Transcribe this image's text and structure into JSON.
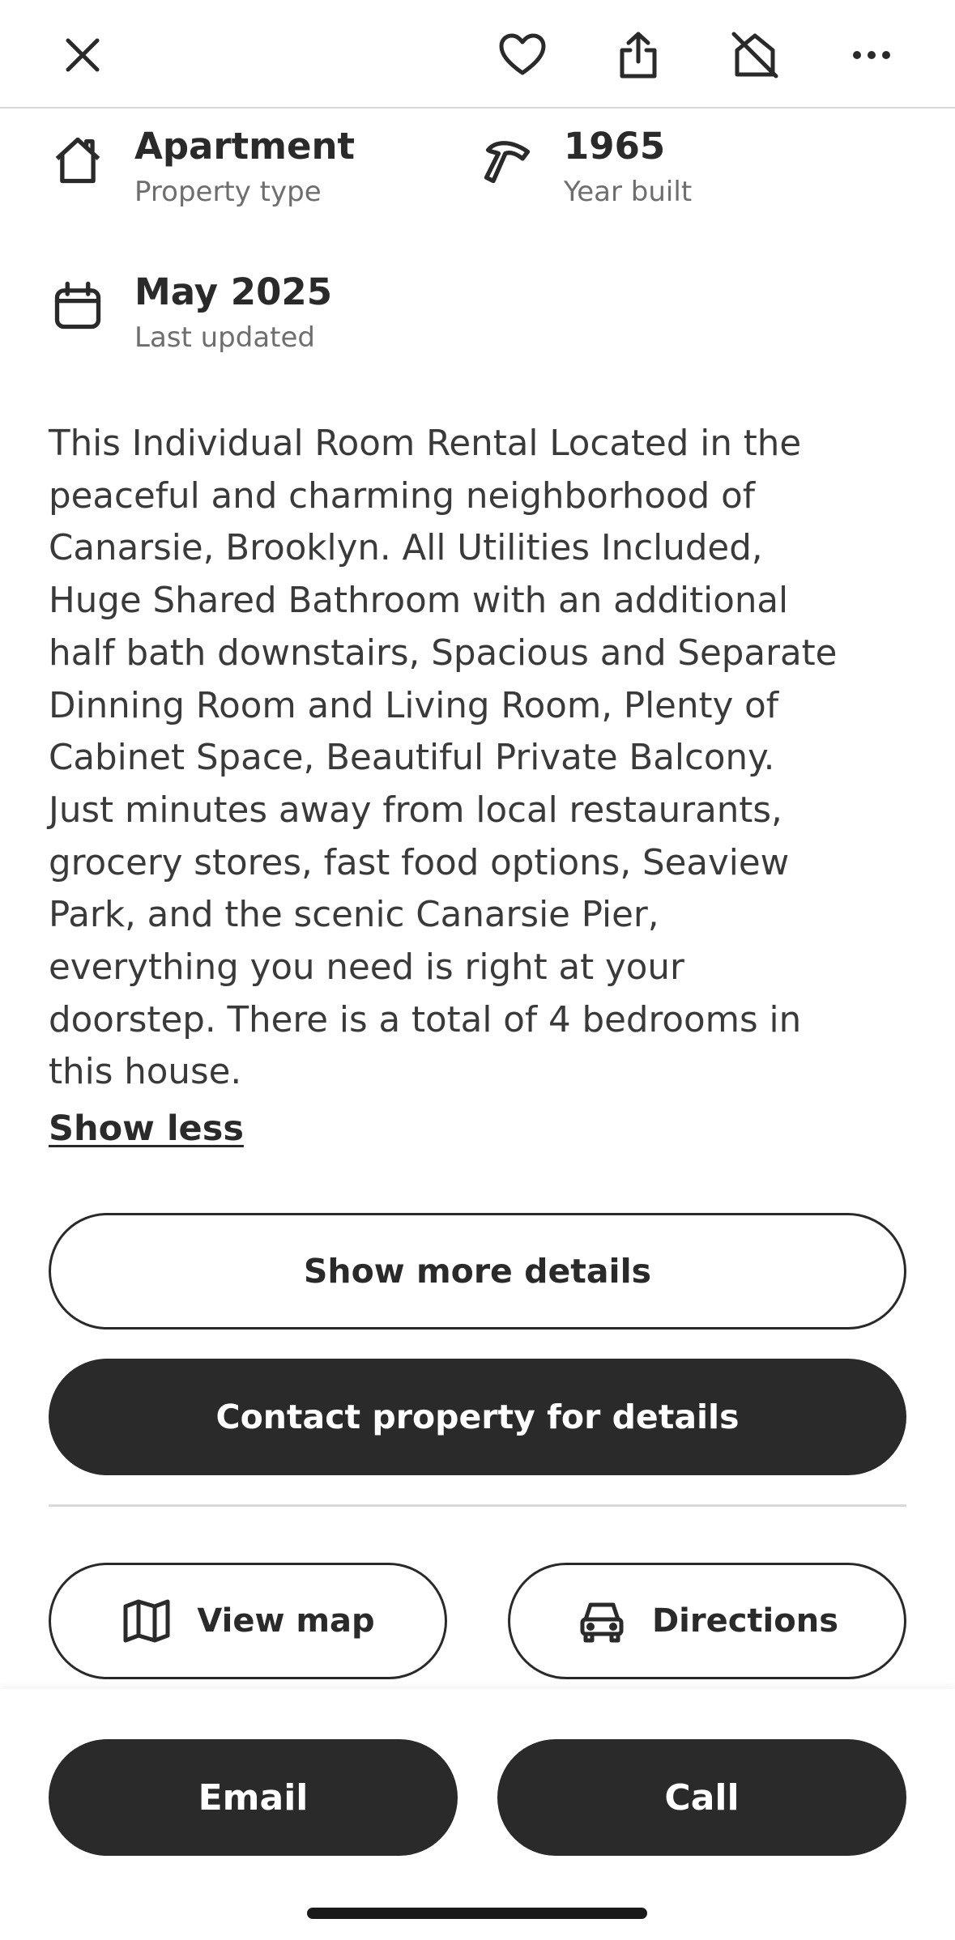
{
  "toolbar": {
    "icons": [
      "close-icon",
      "heart-icon",
      "share-icon",
      "hide-icon",
      "more-icon"
    ]
  },
  "facts": {
    "property_type": {
      "value": "Apartment",
      "label": "Property type",
      "icon": "house-icon"
    },
    "year_built": {
      "value": "1965",
      "label": "Year built",
      "icon": "hammer-icon"
    },
    "last_updated": {
      "value": "May 2025",
      "label": "Last updated",
      "icon": "calendar-icon"
    }
  },
  "description": {
    "lines": [
      "This Individual Room Rental Located in the",
      "peaceful and charming neighborhood of",
      "Canarsie, Brooklyn. All Utilities Included,",
      "Huge Shared Bathroom with an additional",
      "half bath downstairs, Spacious and Separate",
      "Dinning Room and Living Room, Plenty of",
      "Cabinet Space, Beautiful Private Balcony.",
      "Just minutes away from local restaurants,",
      "grocery stores, fast food options, Seaview",
      "Park, and the scenic Canarsie Pier,",
      "everything you need is right at your",
      "doorstep. There is a total of 4 bedrooms in",
      "this house."
    ],
    "toggle_label": "Show less"
  },
  "actions": {
    "show_more_details": "Show more details",
    "contact_property": "Contact property for details",
    "view_map": "View map",
    "directions": "Directions"
  },
  "bottom_bar": {
    "email": "Email",
    "call": "Call"
  },
  "colors": {
    "primary_dark": "#2a2a2a",
    "secondary_text": "#6e6e6e",
    "divider": "#d9d9d9"
  }
}
